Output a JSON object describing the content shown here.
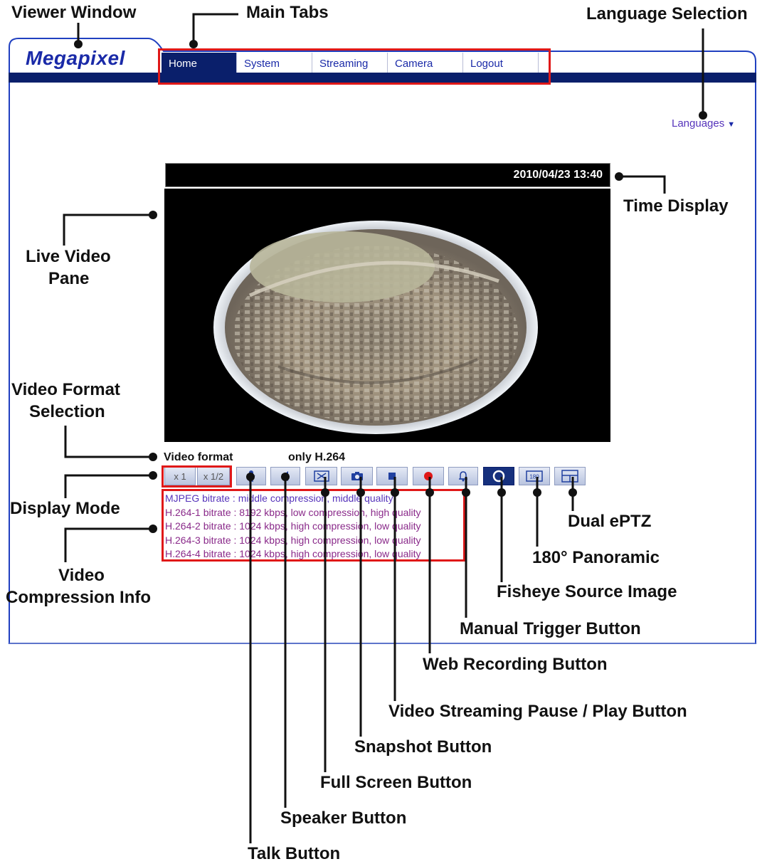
{
  "app": {
    "logo": "Megapixel"
  },
  "tabs": [
    {
      "label": "Home",
      "active": true
    },
    {
      "label": "System",
      "active": false
    },
    {
      "label": "Streaming",
      "active": false
    },
    {
      "label": "Camera",
      "active": false
    },
    {
      "label": "Logout",
      "active": false
    }
  ],
  "language": {
    "label": "Languages",
    "arrow": "▼"
  },
  "video": {
    "timestamp": "2010/04/23 13:40"
  },
  "video_format": {
    "label": "Video format",
    "value": "only H.264"
  },
  "display_mode": {
    "x1": "x 1",
    "x_half": "x 1/2"
  },
  "controls": [
    {
      "icon": "microphone-icon"
    },
    {
      "icon": "speaker-icon"
    },
    {
      "icon": "fullscreen-icon"
    },
    {
      "icon": "camera-icon"
    },
    {
      "icon": "stop-icon"
    },
    {
      "icon": "record-icon"
    },
    {
      "icon": "bell-icon"
    },
    {
      "icon": "circle-icon"
    },
    {
      "icon": "panorama-180-icon",
      "label": "180"
    },
    {
      "icon": "dual-eptz-icon"
    }
  ],
  "compression_info": [
    "MJPEG bitrate : middle compression, middle quality",
    "H.264-1 bitrate : 8192 kbps, low compression, high quality",
    "H.264-2 bitrate : 1024 kbps, high compression, low quality",
    "H.264-3 bitrate : 1024 kbps, high compression, low quality",
    "H.264-4 bitrate : 1024 kbps, high compression, low quality"
  ],
  "annotations": {
    "viewer_window": "Viewer Window",
    "main_tabs": "Main Tabs",
    "language_selection": "Language Selection",
    "time_display": "Time Display",
    "live_video_pane_1": "Live Video",
    "live_video_pane_2": "Pane",
    "video_format_1": "Video Format",
    "video_format_2": "Selection",
    "display_mode": "Display Mode",
    "compression_1": "Video",
    "compression_2": "Compression Info",
    "dual_eptz": "Dual ePTZ",
    "panoramic": "180° Panoramic",
    "fisheye": "Fisheye Source Image",
    "manual_trigger": "Manual Trigger Button",
    "web_recording": "Web Recording Button",
    "pause_play": "Video Streaming Pause / Play Button",
    "snapshot": "Snapshot Button",
    "full_screen": "Full Screen Button",
    "speaker": "Speaker Button",
    "talk": "Talk Button"
  },
  "colors": {
    "navy": "#0a1f6b",
    "highlight": "#e01818",
    "logo": "#1a2aa8"
  }
}
